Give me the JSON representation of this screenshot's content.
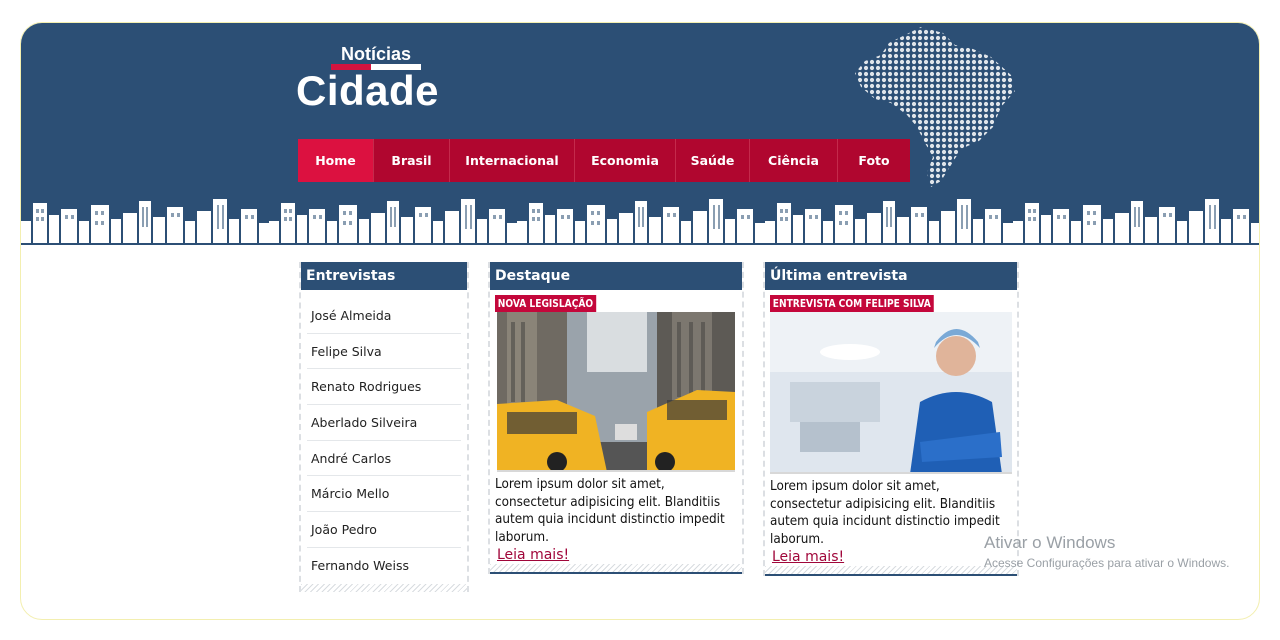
{
  "logo": {
    "small": "Notícias",
    "big": "Cidade"
  },
  "nav": {
    "items": [
      "Home",
      "Brasil",
      "Internacional",
      "Economia",
      "Saúde",
      "Ciência",
      "Foto"
    ],
    "active": "Home"
  },
  "sidebar": {
    "title": "Entrevistas",
    "items": [
      "José Almeida",
      "Felipe Silva",
      "Renato Rodrigues",
      "Aberlado Silveira",
      "André Carlos",
      "Márcio Mello",
      "João Pedro",
      "Fernando Weiss"
    ]
  },
  "destaque": {
    "title": "Destaque",
    "tag": "NOVA LEGISLAÇÃO",
    "text": "Lorem ipsum dolor sit amet, consectetur adipisicing elit. Blanditiis autem quia incidunt distinctio impedit laborum.",
    "link": "Leia mais!"
  },
  "entrevista": {
    "title": "Última entrevista",
    "tag": "ENTREVISTA COM FELIPE SILVA",
    "text": "Lorem ipsum dolor sit amet, consectetur adipisicing elit. Blanditiis autem quia incidunt distinctio impedit laborum.",
    "link": "Leia mais!"
  },
  "watermark": {
    "title": "Ativar o Windows",
    "subtitle": "Acesse Configurações para ativar o Windows."
  },
  "colors": {
    "header": "#2c4f75",
    "nav": "#b0062f",
    "nav_active": "#dc1140",
    "accent": "#c4073b"
  }
}
